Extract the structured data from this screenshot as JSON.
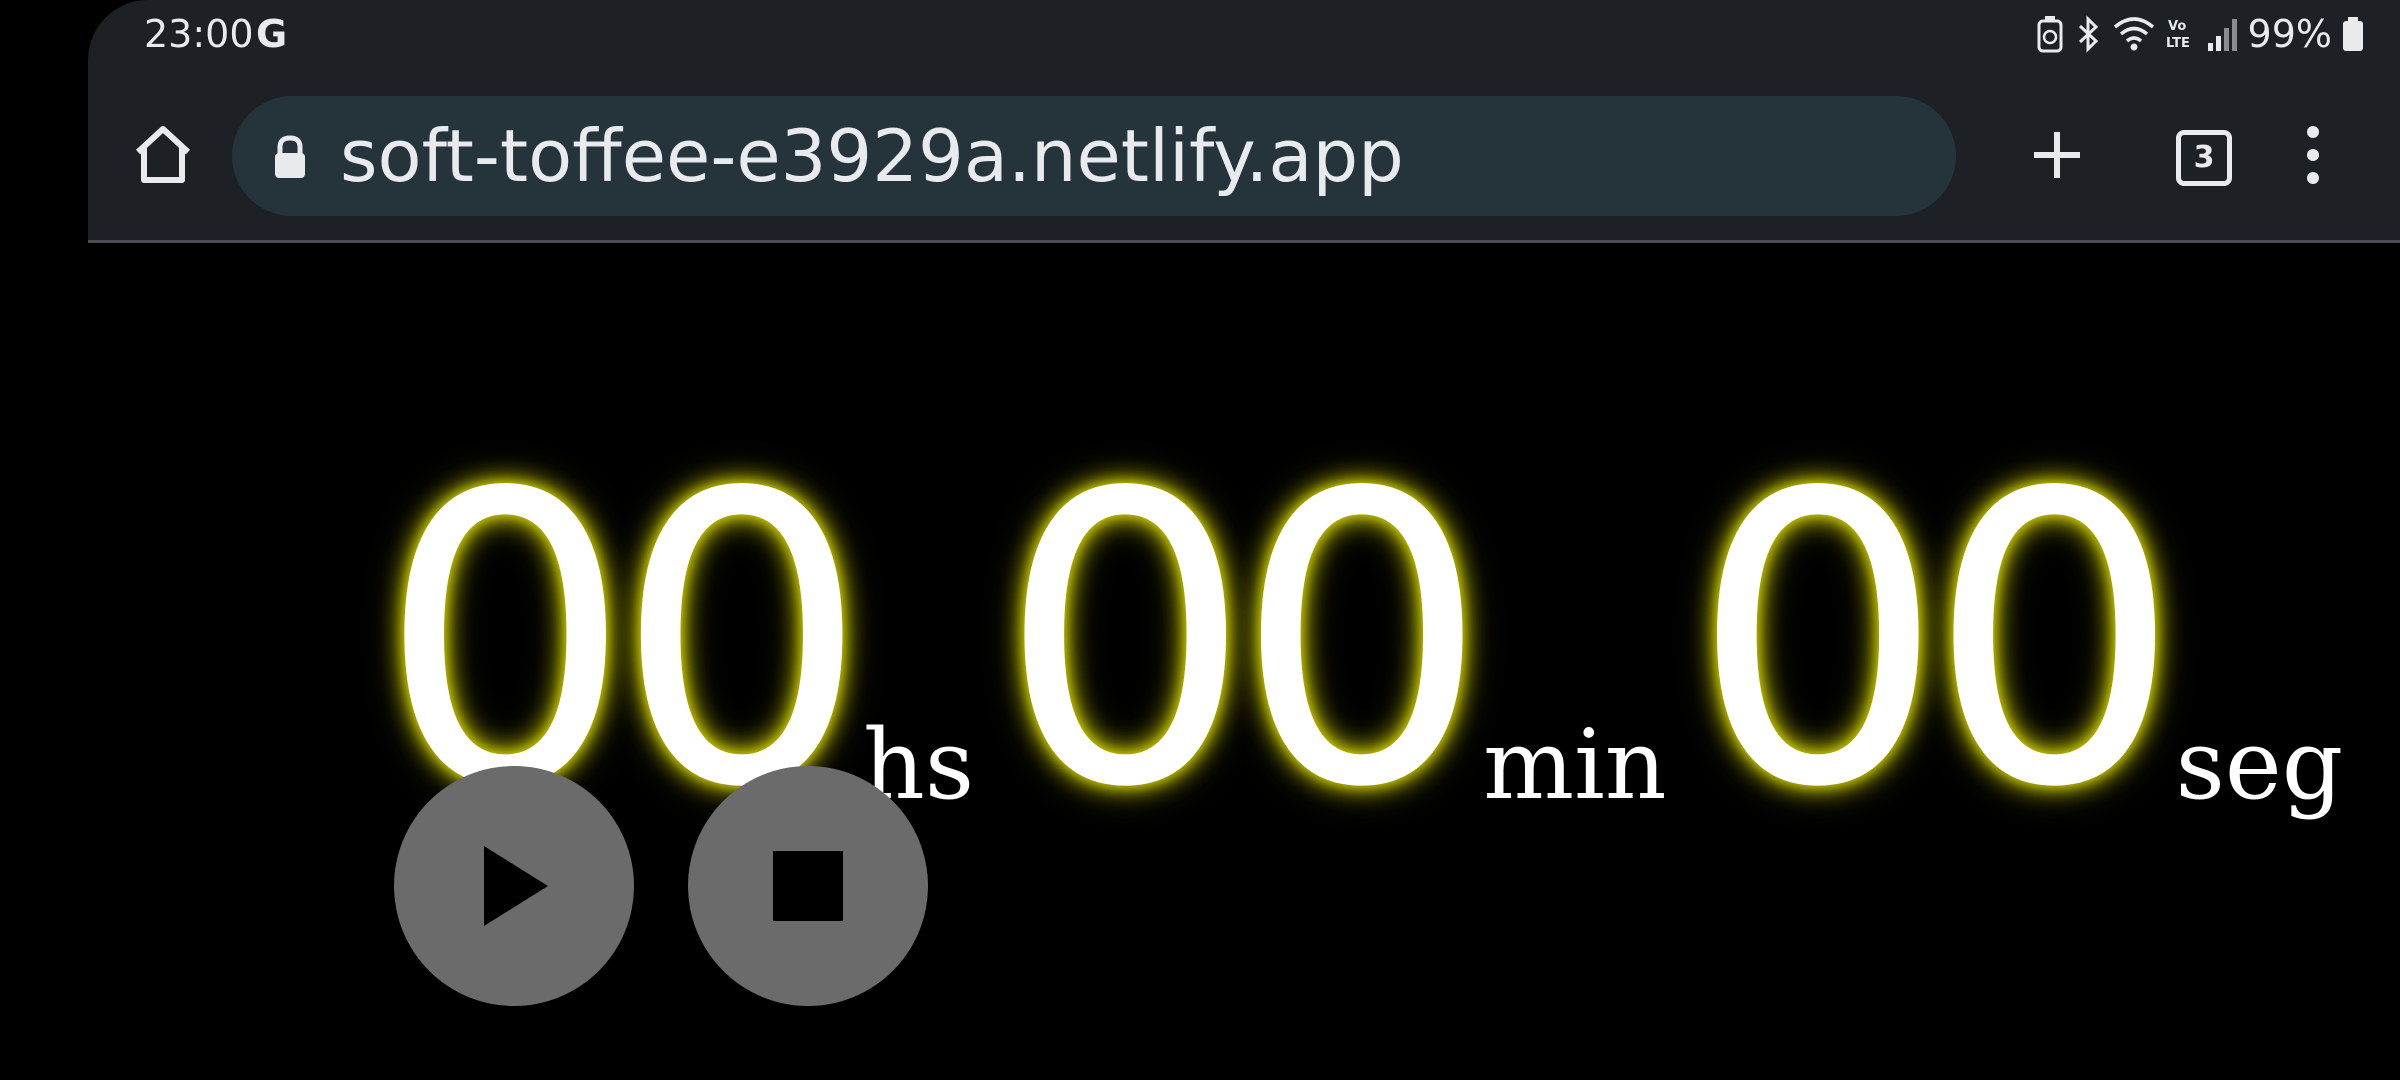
{
  "status_bar": {
    "time": "23:00",
    "g_icon": "G",
    "battery": "99%",
    "icons": [
      "battery-saver-icon",
      "bluetooth-icon",
      "wifi-icon",
      "volte-icon",
      "signal-icon",
      "battery-icon"
    ]
  },
  "toolbar": {
    "url": "soft-toffee-e3929a.netlify.app",
    "tab_count": "3"
  },
  "timer": {
    "hours": "00",
    "hours_unit": "hs",
    "minutes": "00",
    "minutes_unit": "min",
    "seconds": "00",
    "seconds_unit": "seg",
    "glow_color": "#c8c800"
  },
  "controls": {
    "play_icon": "play-icon",
    "stop_icon": "stop-icon",
    "button_color": "#6b6b6b"
  }
}
